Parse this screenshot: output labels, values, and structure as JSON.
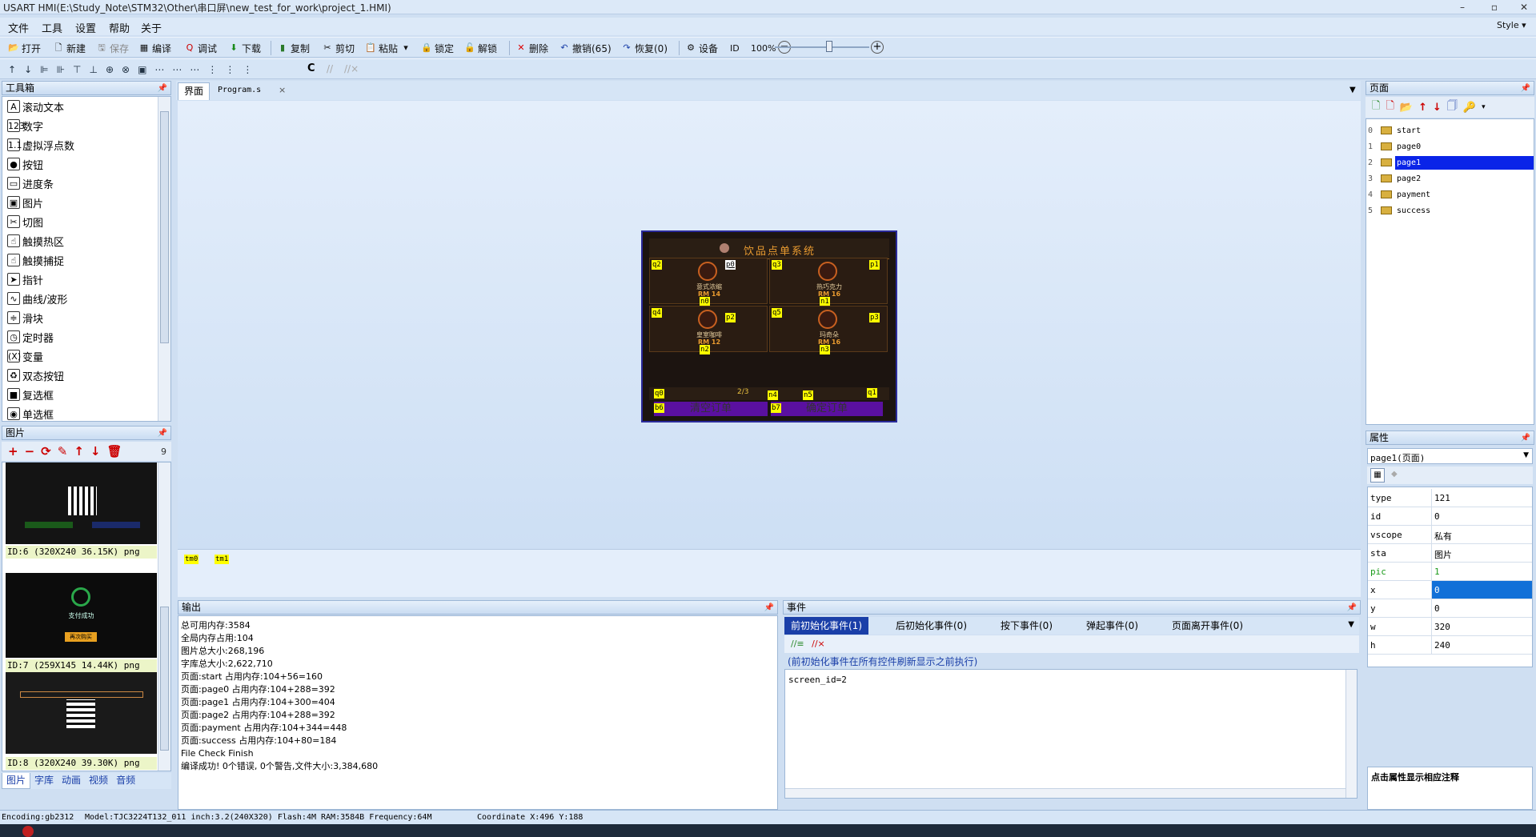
{
  "window": {
    "title": "USART HMI(E:\\Study_Note\\STM32\\Other\\串口屏\\new_test_for_work\\project_1.HMI)",
    "minimize": "–",
    "maximize": "▫",
    "close": "✕"
  },
  "menu": {
    "items": [
      "文件",
      "工具",
      "设置",
      "帮助",
      "关于"
    ],
    "style": "Style ▾"
  },
  "toolbar1": {
    "open": "打开",
    "new": "新建",
    "save": "保存",
    "compile": "编译",
    "debug": "调试",
    "download": "下载",
    "copy": "复制",
    "cut": "剪切",
    "paste": "粘贴",
    "lock": "锁定",
    "unlock": "解锁",
    "delete": "删除",
    "undo": "撤销(65)",
    "redo": "恢复(0)",
    "settings": "设备",
    "id": "ID",
    "zoom": "100%"
  },
  "toolbar2": {
    "c_label": "C"
  },
  "toolbox": {
    "title": "工具箱",
    "items": [
      "滚动文本",
      "数字",
      "虚拟浮点数",
      "按钮",
      "进度条",
      "图片",
      "切图",
      "触摸热区",
      "触摸捕捉",
      "指针",
      "曲线/波形",
      "滑块",
      "定时器",
      "变量",
      "双态按钮",
      "复选框",
      "单选框"
    ],
    "icons": [
      "A",
      "123",
      "1.1",
      "●",
      "▭",
      "▣",
      "✂",
      "☝",
      "☝",
      "➤",
      "∿",
      "≑",
      "◷",
      "(X)",
      "♻",
      "■",
      "◉"
    ]
  },
  "images": {
    "title": "图片",
    "count": "9",
    "items": [
      {
        "label": "ID:6  (320X240 36.15K) png"
      },
      {
        "label": "ID:7  (259X145 14.44K) png",
        "caption": "支付成功",
        "button": "再次购买"
      },
      {
        "label": "ID:8  (320X240 39.30K) png"
      }
    ],
    "bottom_tabs": [
      "图片",
      "字库",
      "动画",
      "视频",
      "音频"
    ]
  },
  "tabs": {
    "design": "界面",
    "program": "Program.s",
    "close": "×"
  },
  "screen": {
    "title": "饮品点单系统",
    "products": [
      {
        "name": "意式浓缩",
        "price": "RM 14",
        "tag_p": "q2",
        "tag_n": "n0",
        "tag_c": "p0"
      },
      {
        "name": "热巧克力",
        "price": "RM 16",
        "tag_p": "q3",
        "tag_n": "n1",
        "tag_c": "p1"
      },
      {
        "name": "皇室咖啡",
        "price": "RM 12",
        "tag_p": "q4",
        "tag_n": "n2",
        "tag_c": "p2"
      },
      {
        "name": "玛奇朵",
        "price": "RM 16",
        "tag_p": "q5",
        "tag_n": "n3",
        "tag_c": "p3"
      }
    ],
    "page_indicator": "2/3",
    "footer_tags": [
      "q0",
      "n4",
      "n5",
      "q1",
      "b6",
      "b7"
    ],
    "btn_clear": "清空订单",
    "btn_confirm": "确定订单"
  },
  "timers": [
    "tm0",
    "tm1"
  ],
  "output": {
    "title": "输出",
    "lines": [
      "总可用内存:3584",
      "全局内存占用:104",
      "图片总大小:268,196",
      "字库总大小:2,622,710",
      "页面:start 占用内存:104+56=160",
      "页面:page0 占用内存:104+288=392",
      "页面:page1 占用内存:104+300=404",
      "页面:page2 占用内存:104+288=392",
      "页面:payment 占用内存:104+344=448",
      "页面:success 占用内存:104+80=184",
      "File Check Finish",
      "编译成功! 0个错误, 0个警告,文件大小:3,384,680"
    ]
  },
  "events": {
    "title": "事件",
    "tabs": [
      "前初始化事件(1)",
      "后初始化事件(0)",
      "按下事件(0)",
      "弹起事件(0)",
      "页面离开事件(0)"
    ],
    "hint": "(前初始化事件在所有控件刷新显示之前执行)",
    "code": "screen_id=2"
  },
  "pages": {
    "title": "页面",
    "items": [
      {
        "n": "0",
        "name": "start"
      },
      {
        "n": "1",
        "name": "page0"
      },
      {
        "n": "2",
        "name": "page1"
      },
      {
        "n": "3",
        "name": "page2"
      },
      {
        "n": "4",
        "name": "payment"
      },
      {
        "n": "5",
        "name": "success"
      }
    ],
    "selected_index": 2
  },
  "properties": {
    "title": "属性",
    "object": "page1(页面)",
    "rows": [
      {
        "k": "type",
        "v": "121"
      },
      {
        "k": "id",
        "v": "0"
      },
      {
        "k": "vscope",
        "v": "私有"
      },
      {
        "k": "sta",
        "v": "图片"
      },
      {
        "k": "pic",
        "v": "1"
      },
      {
        "k": "x",
        "v": "0"
      },
      {
        "k": "y",
        "v": "0"
      },
      {
        "k": "w",
        "v": "320"
      },
      {
        "k": "h",
        "v": "240"
      }
    ],
    "note": "点击属性显示相应注释"
  },
  "statusbar": {
    "encoding": "Encoding:gb2312",
    "model": "Model:TJC3224T132_011  inch:3.2(240X320) Flash:4M RAM:3584B Frequency:64M",
    "coordinate": "Coordinate X:496  Y:188"
  },
  "colors": {
    "accent": "#1a3fa8",
    "selected": "#0a24e8",
    "canvas": "#cfe0f5"
  }
}
